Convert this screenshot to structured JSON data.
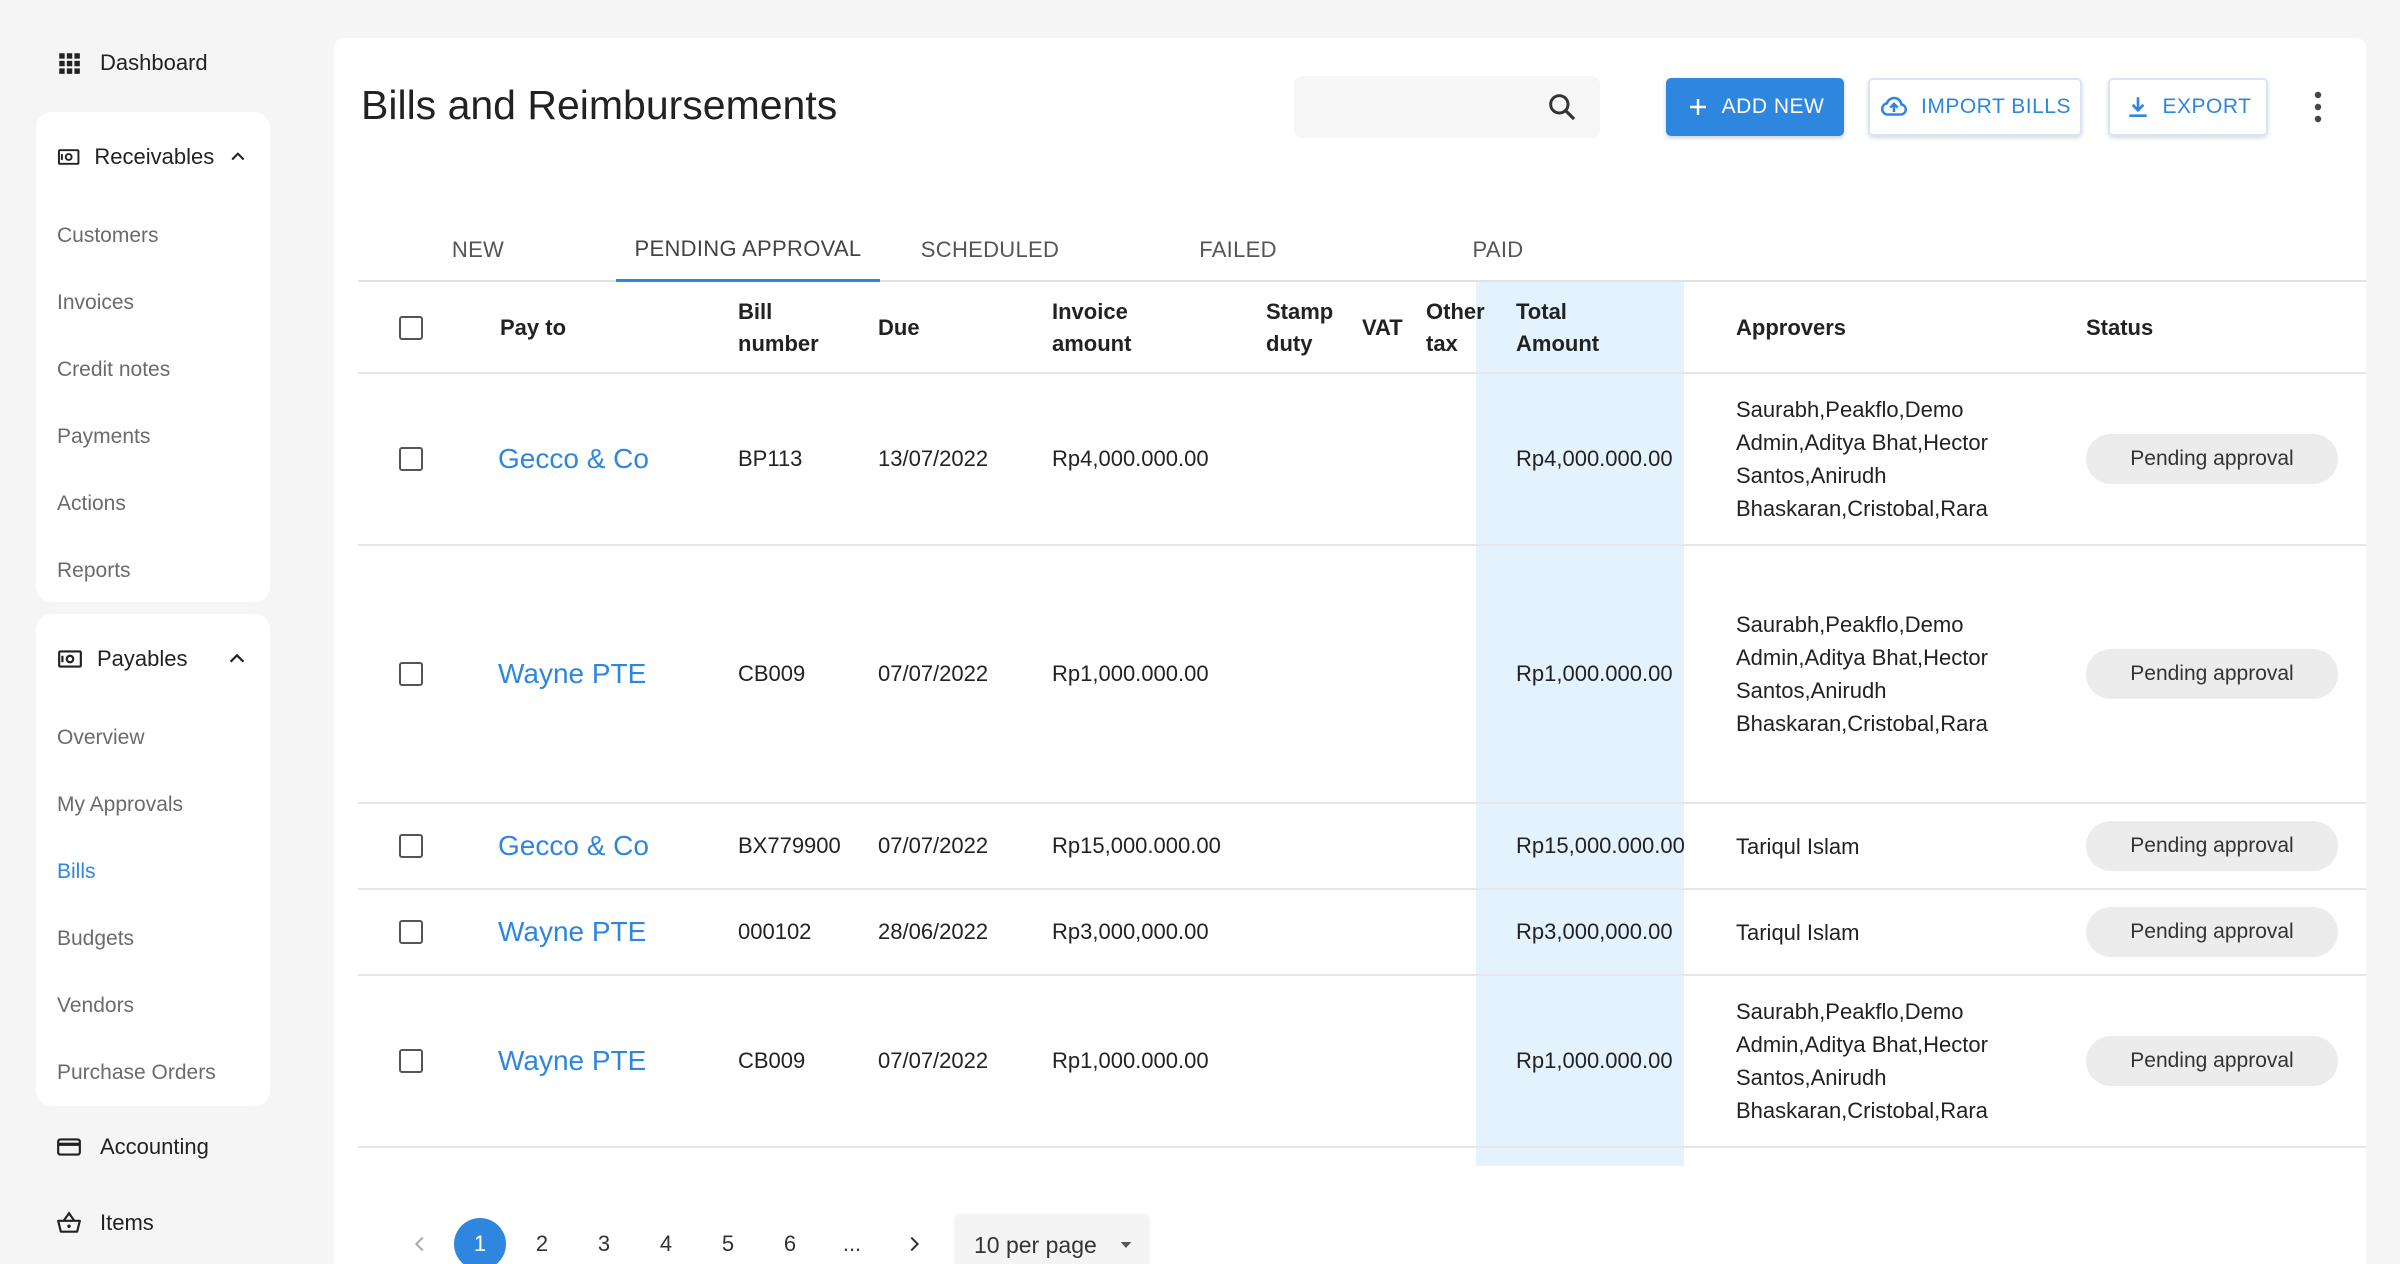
{
  "sidebar": {
    "dashboard": "Dashboard",
    "receivables": {
      "label": "Receivables",
      "items": [
        "Customers",
        "Invoices",
        "Credit notes",
        "Payments",
        "Actions",
        "Reports"
      ]
    },
    "payables": {
      "label": "Payables",
      "items": [
        "Overview",
        "My Approvals",
        "Bills",
        "Budgets",
        "Vendors",
        "Purchase Orders"
      ],
      "active": "Bills"
    },
    "accounting": "Accounting",
    "items": "Items"
  },
  "header": {
    "title": "Bills and Reimbursements",
    "search_placeholder": "",
    "add_new": "ADD NEW",
    "import_bills": "IMPORT BILLS",
    "export": "EXPORT"
  },
  "tabs": [
    "NEW",
    "PENDING APPROVAL",
    "SCHEDULED",
    "FAILED",
    "PAID"
  ],
  "active_tab": "PENDING APPROVAL",
  "table": {
    "columns": {
      "pay_to": "Pay to",
      "bill_number": "Bill number",
      "due": "Due",
      "invoice_amount": "Invoice amount",
      "stamp_duty": "Stamp duty",
      "vat": "VAT",
      "other_tax": "Other tax",
      "total_amount": "Total Amount",
      "approvers": "Approvers",
      "status": "Status"
    },
    "rows": [
      {
        "pay_to": "Gecco & Co",
        "bill_number": "BP113",
        "due": "13/07/2022",
        "invoice_amount": "Rp4,000.000.00",
        "total_amount": "Rp4,000.000.00",
        "approvers": "Saurabh,Peakflo,Demo Admin,Aditya Bhat,Hector Santos,Anirudh Bhaskaran,Cristobal,Rara",
        "status": "Pending approval"
      },
      {
        "pay_to": "Wayne PTE",
        "bill_number": "CB009",
        "due": "07/07/2022",
        "invoice_amount": "Rp1,000.000.00",
        "total_amount": "Rp1,000.000.00",
        "approvers": "Saurabh,Peakflo,Demo Admin,Aditya Bhat,Hector Santos,Anirudh Bhaskaran,Cristobal,Rara",
        "status": "Pending approval"
      },
      {
        "pay_to": "Gecco & Co",
        "bill_number": "BX779900",
        "due": "07/07/2022",
        "invoice_amount": "Rp15,000.000.00",
        "total_amount": "Rp15,000.000.00",
        "approvers": "Tariqul Islam",
        "status": "Pending approval"
      },
      {
        "pay_to": "Wayne PTE",
        "bill_number": "000102",
        "due": "28/06/2022",
        "invoice_amount": "Rp3,000,000.00",
        "total_amount": "Rp3,000,000.00",
        "approvers": "Tariqul Islam",
        "status": "Pending approval"
      },
      {
        "pay_to": "Wayne PTE",
        "bill_number": "CB009",
        "due": "07/07/2022",
        "invoice_amount": "Rp1,000.000.00",
        "total_amount": "Rp1,000.000.00",
        "approvers": "Saurabh,Peakflo,Demo Admin,Aditya Bhat,Hector Santos,Anirudh Bhaskaran,Cristobal,Rara",
        "status": "Pending approval"
      }
    ]
  },
  "pagination": {
    "pages": [
      "1",
      "2",
      "3",
      "4",
      "5",
      "6",
      "..."
    ],
    "current": "1",
    "per_page": "10 per page"
  },
  "colors": {
    "accent": "#2f86de",
    "total_column": "#e4f2fd",
    "status_bg": "#ececec"
  },
  "icons": [
    "grid-icon",
    "receivables-icon",
    "chevron-up-icon",
    "payables-icon",
    "card-icon",
    "basket-icon",
    "search-icon",
    "plus-icon",
    "cloud-upload-icon",
    "download-icon",
    "kebab-icon",
    "chevron-left-icon",
    "chevron-right-icon",
    "caret-down-icon"
  ]
}
